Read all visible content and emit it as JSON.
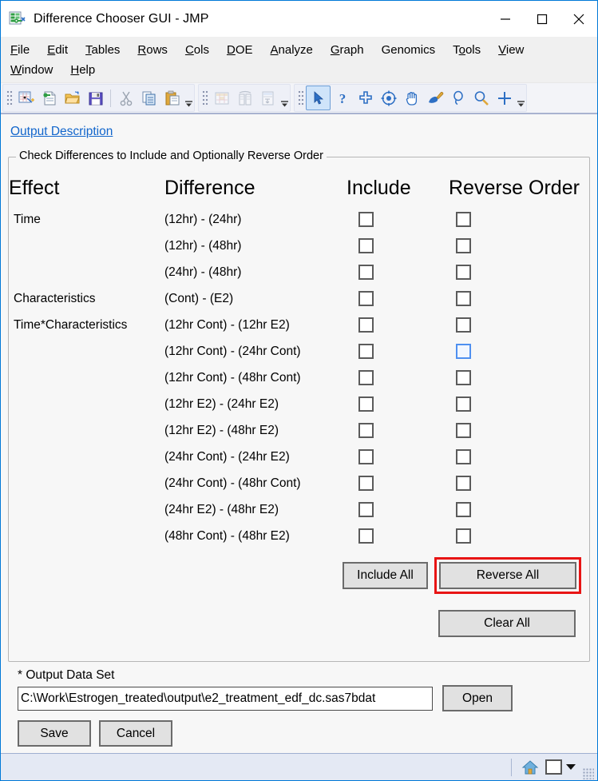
{
  "window": {
    "title": "Difference Chooser GUI - JMP",
    "app_icon": "jmp-table-icon",
    "controls": {
      "minimize": "minimize-icon",
      "maximize": "maximize-icon",
      "close": "close-icon"
    }
  },
  "menubar": {
    "row1": [
      {
        "label": "File",
        "accel": "F"
      },
      {
        "label": "Edit",
        "accel": "E"
      },
      {
        "label": "Tables",
        "accel": "T"
      },
      {
        "label": "Rows",
        "accel": "R"
      },
      {
        "label": "Cols",
        "accel": "C"
      },
      {
        "label": "DOE",
        "accel": "D"
      },
      {
        "label": "Analyze",
        "accel": "A"
      },
      {
        "label": "Graph",
        "accel": "G"
      },
      {
        "label": "Genomics",
        "accel": ""
      },
      {
        "label": "Tools",
        "accel": "o"
      },
      {
        "label": "View",
        "accel": "V"
      }
    ],
    "row2": [
      {
        "label": "Window",
        "accel": "W"
      },
      {
        "label": "Help",
        "accel": "H"
      }
    ]
  },
  "toolbar": {
    "group1": [
      "new-data-table-icon",
      "new-script-icon",
      "open-file-icon",
      "save-icon",
      "cut-icon",
      "copy-icon",
      "paste-icon"
    ],
    "group2": [
      "subset-table-icon",
      "columns-icon",
      "sort-table-icon"
    ],
    "group3": [
      "arrow-select-icon",
      "help-question-icon",
      "crosshair-icon",
      "brush-target-icon",
      "hand-grabber-icon",
      "paintbrush-icon",
      "lasso-magnifier-icon",
      "magnifier-icon",
      "plus-icon"
    ]
  },
  "links": {
    "output_description": "Output Description"
  },
  "groupbox": {
    "legend": "Check Differences to Include and Optionally Reverse Order",
    "headers": {
      "effect": "Effect",
      "difference": "Difference",
      "include": "Include",
      "reverse_order": "Reverse Order"
    },
    "rows": [
      {
        "effect": "Time",
        "difference": "(12hr) - (24hr)",
        "include": false,
        "reverse": false,
        "reverse_focused": false
      },
      {
        "effect": "",
        "difference": "(12hr) - (48hr)",
        "include": false,
        "reverse": false,
        "reverse_focused": false
      },
      {
        "effect": "",
        "difference": "(24hr) - (48hr)",
        "include": false,
        "reverse": false,
        "reverse_focused": false
      },
      {
        "effect": "Characteristics",
        "difference": "(Cont) - (E2)",
        "include": false,
        "reverse": false,
        "reverse_focused": false
      },
      {
        "effect": "Time*Characteristics",
        "difference": "(12hr Cont) - (12hr E2)",
        "include": false,
        "reverse": false,
        "reverse_focused": false
      },
      {
        "effect": "",
        "difference": "(12hr Cont) - (24hr Cont)",
        "include": false,
        "reverse": false,
        "reverse_focused": true
      },
      {
        "effect": "",
        "difference": "(12hr Cont) - (48hr Cont)",
        "include": false,
        "reverse": false,
        "reverse_focused": false
      },
      {
        "effect": "",
        "difference": "(12hr E2) - (24hr E2)",
        "include": false,
        "reverse": false,
        "reverse_focused": false
      },
      {
        "effect": "",
        "difference": "(12hr E2) - (48hr E2)",
        "include": false,
        "reverse": false,
        "reverse_focused": false
      },
      {
        "effect": "",
        "difference": "(24hr Cont) - (24hr E2)",
        "include": false,
        "reverse": false,
        "reverse_focused": false
      },
      {
        "effect": "",
        "difference": "(24hr Cont) - (48hr Cont)",
        "include": false,
        "reverse": false,
        "reverse_focused": false
      },
      {
        "effect": "",
        "difference": "(24hr E2) - (48hr E2)",
        "include": false,
        "reverse": false,
        "reverse_focused": false
      },
      {
        "effect": "",
        "difference": "(48hr Cont) - (48hr E2)",
        "include": false,
        "reverse": false,
        "reverse_focused": false
      }
    ],
    "buttons": {
      "include_all": "Include All",
      "reverse_all": "Reverse All",
      "clear_all": "Clear All"
    },
    "highlight": {
      "target": "reverse_all",
      "color": "#e81414"
    }
  },
  "output": {
    "label": "* Output Data Set",
    "path_value": "C:\\Work\\Estrogen_treated\\output\\e2_treatment_edf_dc.sas7bdat",
    "open_button": "Open"
  },
  "footer": {
    "save": "Save",
    "cancel": "Cancel"
  },
  "statusbar": {
    "home_icon": "home-icon",
    "page_icon": "blank-page-icon",
    "caret_icon": "caret-down-icon"
  }
}
